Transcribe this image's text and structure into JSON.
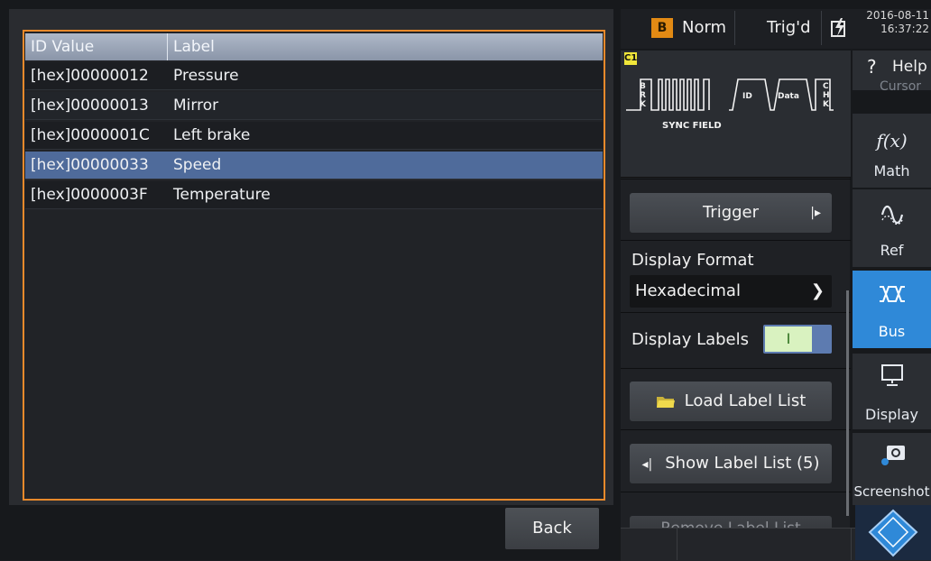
{
  "table": {
    "headers": [
      "ID Value",
      "Label"
    ],
    "rows": [
      {
        "id": "[hex]00000012",
        "label": "Pressure"
      },
      {
        "id": "[hex]00000013",
        "label": "Mirror"
      },
      {
        "id": "[hex]0000001C",
        "label": "Left brake"
      },
      {
        "id": "[hex]00000033",
        "label": "Speed"
      },
      {
        "id": "[hex]0000003F",
        "label": "Temperature"
      }
    ],
    "selected_row": 3
  },
  "back_label": "Back",
  "status": {
    "trigger_source": "B",
    "trigger_mode": "Norm",
    "trigger_state": "Trig'd",
    "date": "2016-08-11",
    "time": "16:37:22"
  },
  "protocol": {
    "channel_badge": "C1",
    "brk": "B R K",
    "id": "ID",
    "data": "Data",
    "chk": "C H K",
    "sync_field": "SYNC FIELD"
  },
  "menu": {
    "trigger_label": "Trigger",
    "display_format_label": "Display Format",
    "display_format_value": "Hexadecimal",
    "display_labels_label": "Display Labels",
    "display_labels_toggle": "I",
    "load_label_list": "Load Label List",
    "show_label_list": "Show Label List (5)",
    "remove_label_list": "Remove Label List"
  },
  "toolbar": {
    "help": "Help",
    "cursor": "Cursor",
    "math": "Math",
    "math_glyph": "f(x)",
    "ref": "Ref",
    "bus": "Bus",
    "display": "Display",
    "screenshot": "Screenshot",
    "active": "Bus"
  },
  "colors": {
    "accent_orange": "#e8892b",
    "selected_row": "#4f6b9b",
    "active_tool": "#2f89d8",
    "trigger_source_bg": "#e28a14",
    "channel_yellow": "#f0e63a"
  }
}
